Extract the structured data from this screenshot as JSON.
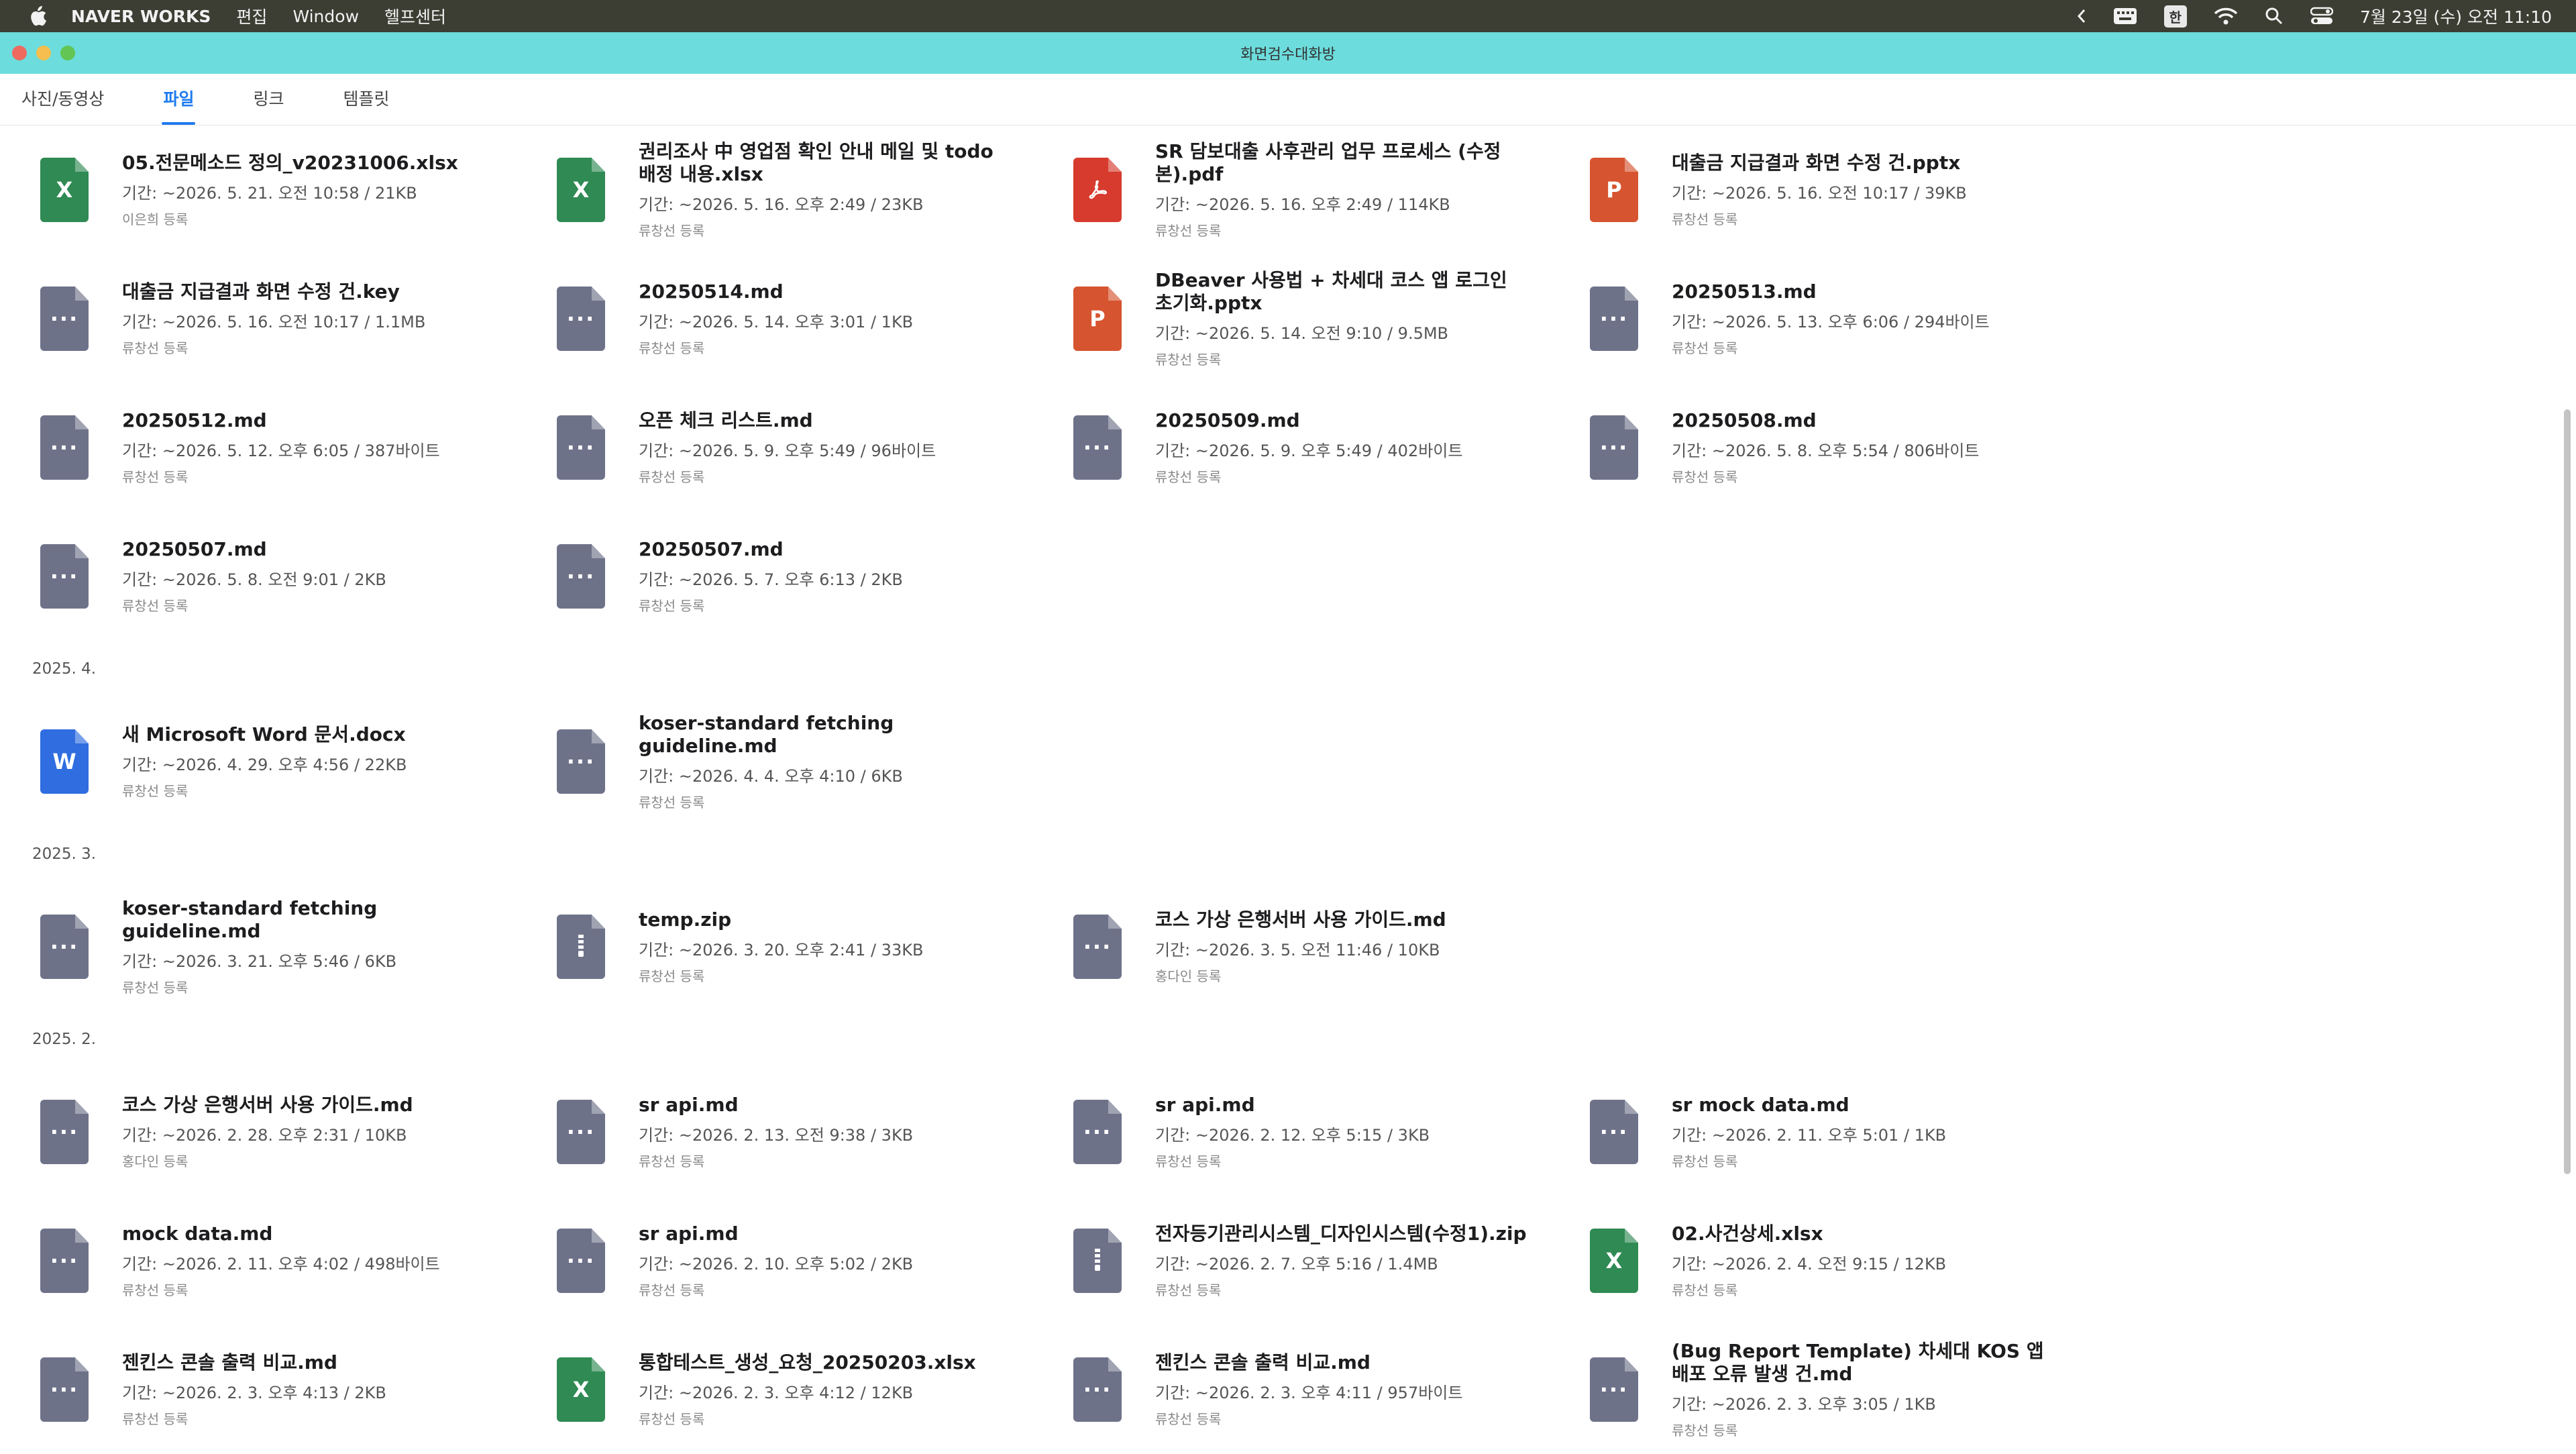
{
  "menubar": {
    "app_name": "NAVER WORKS",
    "menus": [
      "편집",
      "Window",
      "헬프센터"
    ],
    "ime": "한",
    "clock": "7월 23일 (수) 오전 11:10"
  },
  "window": {
    "title": "화면검수대화방"
  },
  "tabs": [
    {
      "label": "사진/동영상",
      "active": false
    },
    {
      "label": "파일",
      "active": true
    },
    {
      "label": "링크",
      "active": false
    },
    {
      "label": "템플릿",
      "active": false
    }
  ],
  "icons": {
    "doc": "···",
    "xlsx": "X",
    "pptx": "P",
    "docx": "W",
    "pdf": "pdf-icon",
    "zip": "zip-icon"
  },
  "colors": {
    "titlebar": "#6ddcdc",
    "accent": "#1f7bf0",
    "xlsx": "#2f8a53",
    "pdf": "#d63b2e",
    "pptx": "#d6542f",
    "docx": "#2f6de0",
    "doc": "#6e7289"
  },
  "rows": [
    [
      {
        "type": "xlsx",
        "name": "05.전문메소드 정의_v20231006.xlsx",
        "meta": "기간: ~2026. 5. 21. 오전 10:58 / 21KB",
        "owner": "이은희 등록"
      },
      {
        "type": "xlsx",
        "name": "권리조사 中 영업점 확인 안내 메일 및 todo 배정 내용.xlsx",
        "meta": "기간: ~2026. 5. 16. 오후 2:49 / 23KB",
        "owner": "류창선 등록"
      },
      {
        "type": "pdf",
        "name": "SR 담보대출 사후관리 업무 프로세스 (수정본).pdf",
        "meta": "기간: ~2026. 5. 16. 오후 2:49 / 114KB",
        "owner": "류창선 등록"
      },
      {
        "type": "pptx",
        "name": "대출금 지급결과 화면 수정 건.pptx",
        "meta": "기간: ~2026. 5. 16. 오전 10:17 / 39KB",
        "owner": "류창선 등록"
      }
    ],
    [
      {
        "type": "doc",
        "name": "대출금 지급결과 화면 수정 건.key",
        "meta": "기간: ~2026. 5. 16. 오전 10:17 / 1.1MB",
        "owner": "류창선 등록"
      },
      {
        "type": "doc",
        "name": "20250514.md",
        "meta": "기간: ~2026. 5. 14. 오후 3:01 / 1KB",
        "owner": "류창선 등록"
      },
      {
        "type": "pptx",
        "name": "DBeaver 사용법 + 차세대 코스 앱 로그인 초기화.pptx",
        "meta": "기간: ~2026. 5. 14. 오전 9:10 / 9.5MB",
        "owner": "류창선 등록"
      },
      {
        "type": "doc",
        "name": "20250513.md",
        "meta": "기간: ~2026. 5. 13. 오후 6:06 / 294바이트",
        "owner": "류창선 등록"
      }
    ],
    [
      {
        "type": "doc",
        "name": "20250512.md",
        "meta": "기간: ~2026. 5. 12. 오후 6:05 / 387바이트",
        "owner": "류창선 등록"
      },
      {
        "type": "doc",
        "name": "오픈 체크 리스트.md",
        "meta": "기간: ~2026. 5. 9. 오후 5:49 / 96바이트",
        "owner": "류창선 등록"
      },
      {
        "type": "doc",
        "name": "20250509.md",
        "meta": "기간: ~2026. 5. 9. 오후 5:49 / 402바이트",
        "owner": "류창선 등록"
      },
      {
        "type": "doc",
        "name": "20250508.md",
        "meta": "기간: ~2026. 5. 8. 오후 5:54 / 806바이트",
        "owner": "류창선 등록"
      }
    ],
    [
      {
        "type": "doc",
        "name": "20250507.md",
        "meta": "기간: ~2026. 5. 8. 오전 9:01 / 2KB",
        "owner": "류창선 등록"
      },
      {
        "type": "doc",
        "name": "20250507.md",
        "meta": "기간: ~2026. 5. 7. 오후 6:13 / 2KB",
        "owner": "류창선 등록"
      },
      null,
      null
    ],
    {
      "section": "2025. 4."
    },
    [
      {
        "type": "docx",
        "name": "새 Microsoft Word 문서.docx",
        "meta": "기간: ~2026. 4. 29. 오후 4:56 / 22KB",
        "owner": "류창선 등록"
      },
      {
        "type": "doc",
        "name": "koser-standard fetching guideline.md",
        "meta": "기간: ~2026. 4. 4. 오후 4:10 / 6KB",
        "owner": "류창선 등록"
      },
      null,
      null
    ],
    {
      "section": "2025. 3."
    },
    [
      {
        "type": "doc",
        "name": "koser-standard fetching guideline.md",
        "meta": "기간: ~2026. 3. 21. 오후 5:46 / 6KB",
        "owner": "류창선 등록"
      },
      {
        "type": "zip",
        "name": "temp.zip",
        "meta": "기간: ~2026. 3. 20. 오후 2:41 / 33KB",
        "owner": "류창선 등록"
      },
      {
        "type": "doc",
        "name": "코스 가상 은행서버 사용 가이드.md",
        "meta": "기간: ~2026. 3. 5. 오전 11:46 / 10KB",
        "owner": "홍다인 등록"
      },
      null
    ],
    {
      "section": "2025. 2."
    },
    [
      {
        "type": "doc",
        "name": "코스 가상 은행서버 사용 가이드.md",
        "meta": "기간: ~2026. 2. 28. 오후 2:31 / 10KB",
        "owner": "홍다인 등록"
      },
      {
        "type": "doc",
        "name": "sr api.md",
        "meta": "기간: ~2026. 2. 13. 오전 9:38 / 3KB",
        "owner": "류창선 등록"
      },
      {
        "type": "doc",
        "name": "sr api.md",
        "meta": "기간: ~2026. 2. 12. 오후 5:15 / 3KB",
        "owner": "류창선 등록"
      },
      {
        "type": "doc",
        "name": "sr mock data.md",
        "meta": "기간: ~2026. 2. 11. 오후 5:01 / 1KB",
        "owner": "류창선 등록"
      }
    ],
    [
      {
        "type": "doc",
        "name": "mock data.md",
        "meta": "기간: ~2026. 2. 11. 오후 4:02 / 498바이트",
        "owner": "류창선 등록"
      },
      {
        "type": "doc",
        "name": "sr api.md",
        "meta": "기간: ~2026. 2. 10. 오후 5:02 / 2KB",
        "owner": "류창선 등록"
      },
      {
        "type": "zip",
        "name": "전자등기관리시스템_디자인시스템(수정1).zip",
        "meta": "기간: ~2026. 2. 7. 오후 5:16 / 1.4MB",
        "owner": "류창선 등록"
      },
      {
        "type": "xlsx",
        "name": "02.사건상세.xlsx",
        "meta": "기간: ~2026. 2. 4. 오전 9:15 / 12KB",
        "owner": "류창선 등록"
      }
    ],
    [
      {
        "type": "doc",
        "name": "젠킨스 콘솔 출력 비교.md",
        "meta": "기간: ~2026. 2. 3. 오후 4:13 / 2KB",
        "owner": "류창선 등록"
      },
      {
        "type": "xlsx",
        "name": "통합테스트_생성_요청_20250203.xlsx",
        "meta": "기간: ~2026. 2. 3. 오후 4:12 / 12KB",
        "owner": "류창선 등록"
      },
      {
        "type": "doc",
        "name": "젠킨스 콘솔 출력 비교.md",
        "meta": "기간: ~2026. 2. 3. 오후 4:11 / 957바이트",
        "owner": "류창선 등록"
      },
      {
        "type": "doc",
        "name": "(Bug Report Template) 차세대 KOS 앱 배포 오류 발생 건.md",
        "meta": "기간: ~2026. 2. 3. 오후 3:05 / 1KB",
        "owner": "류창선 등록"
      }
    ]
  ]
}
